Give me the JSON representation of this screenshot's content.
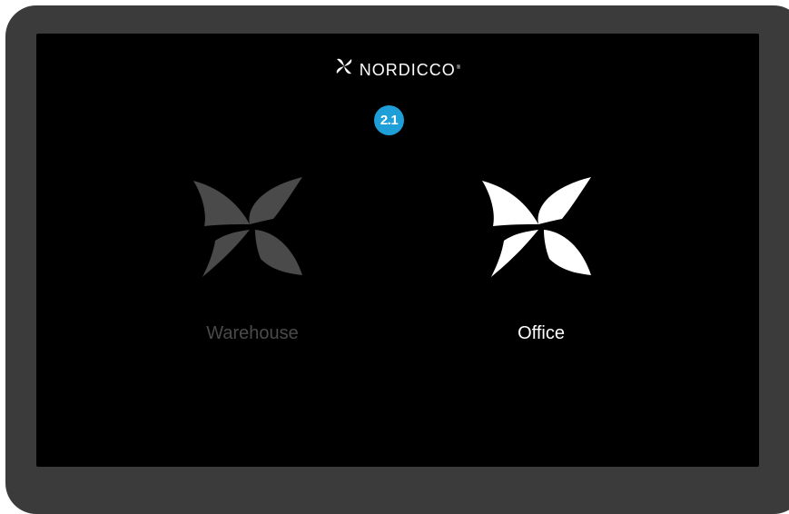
{
  "brand": {
    "name": "NORDICCO",
    "registered": "®",
    "icon": "pinwheel-logo-icon"
  },
  "step_badge": {
    "text": "2.1",
    "color": "#1f9fd8"
  },
  "options": {
    "warehouse": {
      "label": "Warehouse",
      "icon": "pinwheel-icon",
      "selected": false,
      "color": "#4a4a4a"
    },
    "office": {
      "label": "Office",
      "icon": "pinwheel-icon",
      "selected": true,
      "color": "#ffffff"
    }
  },
  "colors": {
    "bezel": "#3b3b3b",
    "screen": "#000000"
  }
}
